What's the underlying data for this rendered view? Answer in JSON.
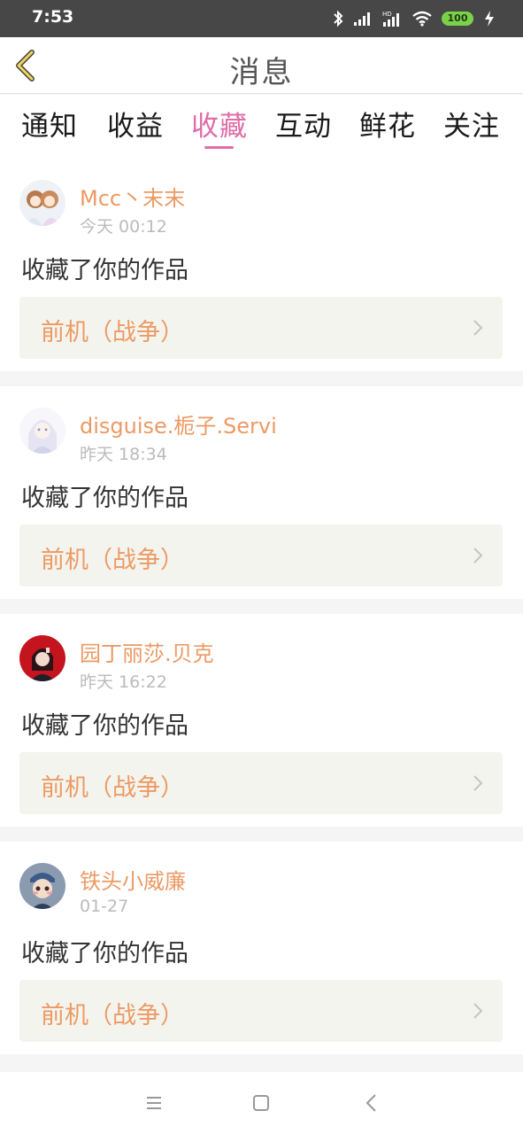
{
  "status_bar": {
    "time": "7:53",
    "battery": "100",
    "icons": [
      "bluetooth-icon",
      "signal-icon",
      "hd-signal-icon",
      "wifi-icon",
      "battery-icon",
      "charging-icon"
    ]
  },
  "header": {
    "title": "消息",
    "back_icon": "chevron-left-icon"
  },
  "tabs": [
    {
      "label": "通知",
      "active": false
    },
    {
      "label": "收益",
      "active": false
    },
    {
      "label": "收藏",
      "active": true
    },
    {
      "label": "互动",
      "active": false
    },
    {
      "label": "鲜花",
      "active": false
    },
    {
      "label": "关注",
      "active": false
    }
  ],
  "colors": {
    "accent": "#e06ca8",
    "username": "#ec9a64",
    "work_box_bg": "#f4f4ee",
    "status_bar_bg": "#474747"
  },
  "notifications": [
    {
      "user": "Mcc丶末末",
      "time": "今天 00:12",
      "action": "收藏了你的作品",
      "work": "前机（战争）"
    },
    {
      "user": "disguise.栀子.Servi",
      "time": "昨天 18:34",
      "action": "收藏了你的作品",
      "work": "前机（战争）"
    },
    {
      "user": "园丁丽莎.贝克",
      "time": "昨天 16:22",
      "action": "收藏了你的作品",
      "work": "前机（战争）"
    },
    {
      "user": "铁头小威廉",
      "time": "01-27",
      "action": "收藏了你的作品",
      "work": "前机（战争）"
    }
  ],
  "nav_bar": {
    "icons": [
      "menu-icon",
      "home-square-icon",
      "back-icon"
    ]
  }
}
